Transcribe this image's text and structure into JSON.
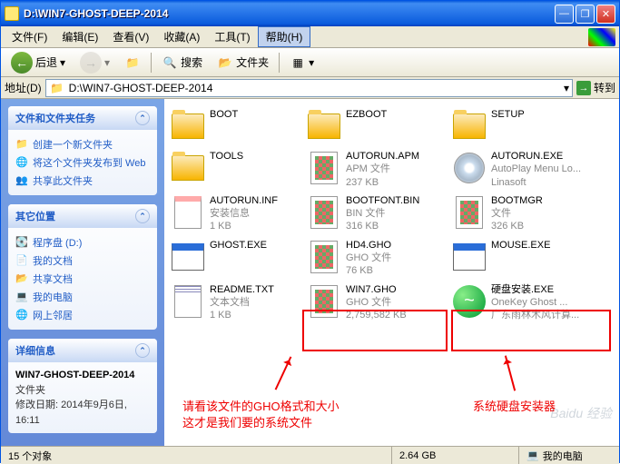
{
  "window": {
    "title": "D:\\WIN7-GHOST-DEEP-2014"
  },
  "menu": {
    "file": "文件(F)",
    "edit": "编辑(E)",
    "view": "查看(V)",
    "favorites": "收藏(A)",
    "tools": "工具(T)",
    "help": "帮助(H)"
  },
  "toolbar": {
    "back": "后退",
    "search": "搜索",
    "folders": "文件夹"
  },
  "address": {
    "label": "地址(D)",
    "path": "D:\\WIN7-GHOST-DEEP-2014",
    "go": "转到"
  },
  "sidebar": {
    "tasks": {
      "title": "文件和文件夹任务",
      "items": [
        "创建一个新文件夹",
        "将这个文件夹发布到 Web",
        "共享此文件夹"
      ]
    },
    "places": {
      "title": "其它位置",
      "items": [
        "程序盘 (D:)",
        "我的文档",
        "共享文档",
        "我的电脑",
        "网上邻居"
      ]
    },
    "details": {
      "title": "详细信息",
      "name": "WIN7-GHOST-DEEP-2014",
      "type": "文件夹",
      "modified_label": "修改日期:",
      "modified": "2014年9月6日, 16:11"
    }
  },
  "files": [
    {
      "name": "BOOT",
      "type": "folder"
    },
    {
      "name": "EZBOOT",
      "type": "folder"
    },
    {
      "name": "SETUP",
      "type": "folder"
    },
    {
      "name": "TOOLS",
      "type": "folder"
    },
    {
      "name": "AUTORUN.APM",
      "line2": "APM 文件",
      "line3": "237 KB",
      "icon": "gho"
    },
    {
      "name": "AUTORUN.EXE",
      "line2": "AutoPlay Menu Lo...",
      "line3": "Linasoft",
      "icon": "cd"
    },
    {
      "name": "AUTORUN.INF",
      "line2": "安装信息",
      "line3": "1 KB",
      "icon": "ini"
    },
    {
      "name": "BOOTFONT.BIN",
      "line2": "BIN 文件",
      "line3": "316 KB",
      "icon": "gho"
    },
    {
      "name": "BOOTMGR",
      "line2": "文件",
      "line3": "326 KB",
      "icon": "gho"
    },
    {
      "name": "GHOST.EXE",
      "icon": "exe"
    },
    {
      "name": "HD4.GHO",
      "line2": "GHO 文件",
      "line3": "76 KB",
      "icon": "gho"
    },
    {
      "name": "MOUSE.EXE",
      "icon": "exe"
    },
    {
      "name": "README.TXT",
      "line2": "文本文档",
      "line3": "1 KB",
      "icon": "txt"
    },
    {
      "name": "WIN7.GHO",
      "line2": "GHO 文件",
      "line3": "2,759,582 KB",
      "icon": "gho"
    },
    {
      "name": "硬盘安装.EXE",
      "line2": "OneKey Ghost ...",
      "line3": "广东雨林木风计算...",
      "icon": "swirl"
    }
  ],
  "annotations": {
    "left1": "请看该文件的GHO格式和大小",
    "left2": "这才是我们要的系统文件",
    "right": "系统硬盘安装器"
  },
  "status": {
    "count": "15 个对象",
    "size": "2.64 GB",
    "location": "我的电脑"
  },
  "watermark": "Baidu 经验"
}
